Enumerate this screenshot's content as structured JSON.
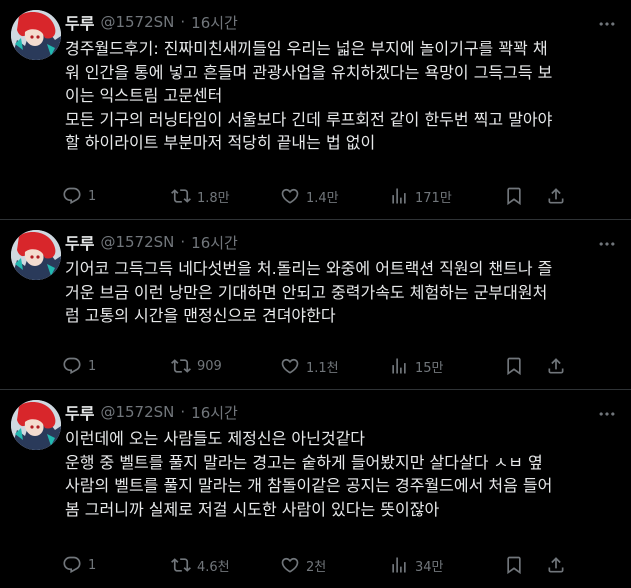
{
  "colors": {
    "background": "#000000",
    "text": "#e7e9ea",
    "muted": "#71767b",
    "divider": "#2f3336"
  },
  "tweets": [
    {
      "name": "두루",
      "handle": "@1572SN",
      "sep": "·",
      "time": "16시간",
      "text": "경주월드후기: 진짜미친새끼들임 우리는 넓은 부지에 놀이기구를 꽉꽉 채\n워 인간을 통에 넣고 흔들며 관광사업을 유치하겠다는 욕망이 그득그득 보\n이는 익스트림 고문센터\n모든 기구의 러닝타임이 서울보다 긴데 루프회전 같이 한두번 찍고 말아야\n할 하이라이트 부분마저 적당히 끝내는 법 없이",
      "replies": "1",
      "retweets": "1.8만",
      "likes": "1.4만",
      "views": "171만"
    },
    {
      "name": "두루",
      "handle": "@1572SN",
      "sep": "·",
      "time": "16시간",
      "text": "기어코 그득그득 네다섯번을 처.돌리는 와중에 어트랙션 직원의 챈트나 즐\n거운 브금 이런 낭만은 기대하면 안되고 중력가속도 체험하는 군부대원처\n럼 고통의 시간을 맨정신으로 견뎌야한다",
      "replies": "1",
      "retweets": "909",
      "likes": "1.1천",
      "views": "15만"
    },
    {
      "name": "두루",
      "handle": "@1572SN",
      "sep": "·",
      "time": "16시간",
      "text": "이런데에 오는 사람들도 제정신은 아닌것같다\n운행 중 벨트를 풀지 말라는 경고는 숱하게 들어봤지만 살다살다 ㅅㅂ 옆\n사람의 벨트를 풀지 말라는 개 참돌이같은 공지는 경주월드에서 처음 들어\n봄 그러니까 실제로 저걸 시도한 사람이 있다는 뜻이잖아",
      "replies": "1",
      "retweets": "4.6천",
      "likes": "2천",
      "views": "34만"
    }
  ]
}
